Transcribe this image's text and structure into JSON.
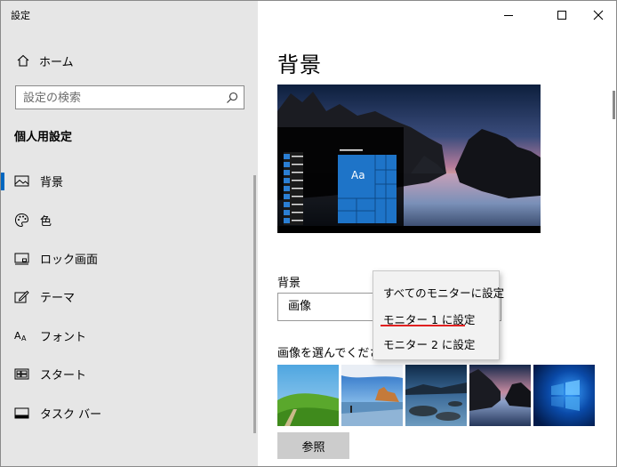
{
  "window": {
    "title": "設定"
  },
  "sidebar": {
    "home_label": "ホーム",
    "search_placeholder": "設定の検索",
    "section_title": "個人用設定",
    "items": [
      {
        "label": "背景",
        "icon": "picture-icon",
        "active": true
      },
      {
        "label": "色",
        "icon": "palette-icon",
        "active": false
      },
      {
        "label": "ロック画面",
        "icon": "lock-screen-icon",
        "active": false
      },
      {
        "label": "テーマ",
        "icon": "theme-icon",
        "active": false
      },
      {
        "label": "フォント",
        "icon": "font-icon",
        "active": false
      },
      {
        "label": "スタート",
        "icon": "start-icon",
        "active": false
      },
      {
        "label": "タスク バー",
        "icon": "taskbar-icon",
        "active": false
      }
    ]
  },
  "main": {
    "page_title": "背景",
    "preview_tile_text": "Aa",
    "background_label": "背景",
    "background_value": "画像",
    "choose_label": "画像を選んでくださ",
    "browse_label": "参照"
  },
  "context_menu": {
    "items": [
      "すべてのモニターに設定",
      "モニター 1 に設定",
      "モニター 2 に設定"
    ],
    "highlighted_index": 1
  },
  "colors": {
    "sidebar_bg": "#e6e6e6",
    "accent": "#0067c0",
    "tile_blue": "#1e74c8",
    "underline_red": "#e02020"
  }
}
